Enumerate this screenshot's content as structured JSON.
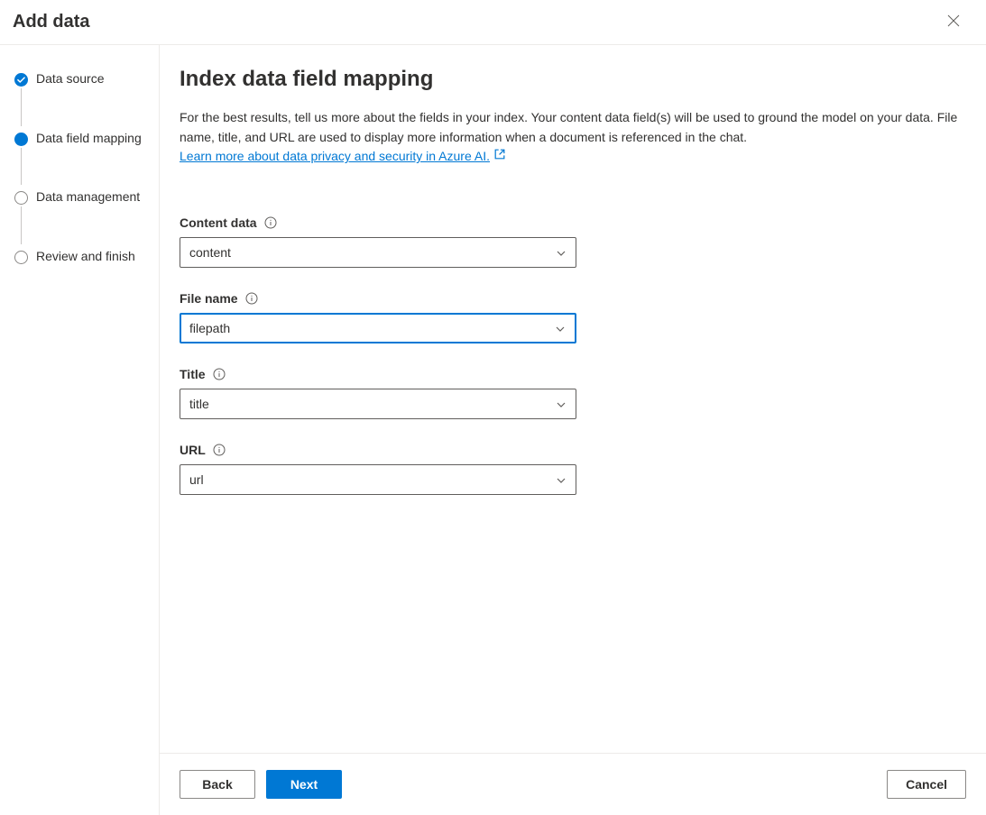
{
  "header": {
    "title": "Add data"
  },
  "sidebar": {
    "steps": [
      {
        "label": "Data source",
        "state": "completed"
      },
      {
        "label": "Data field mapping",
        "state": "current"
      },
      {
        "label": "Data management",
        "state": "upcoming"
      },
      {
        "label": "Review and finish",
        "state": "upcoming"
      }
    ]
  },
  "main": {
    "title": "Index data field mapping",
    "description": "For the best results, tell us more about the fields in your index. Your content data field(s) will be used to ground the model on your data. File name, title, and URL are used to display more information when a document is referenced in the chat.",
    "link_text": "Learn more about data privacy and security in Azure AI.",
    "fields": [
      {
        "label": "Content data",
        "value": "content",
        "focused": false
      },
      {
        "label": "File name",
        "value": "filepath",
        "focused": true
      },
      {
        "label": "Title",
        "value": "title",
        "focused": false
      },
      {
        "label": "URL",
        "value": "url",
        "focused": false
      }
    ]
  },
  "footer": {
    "back": "Back",
    "next": "Next",
    "cancel": "Cancel"
  }
}
